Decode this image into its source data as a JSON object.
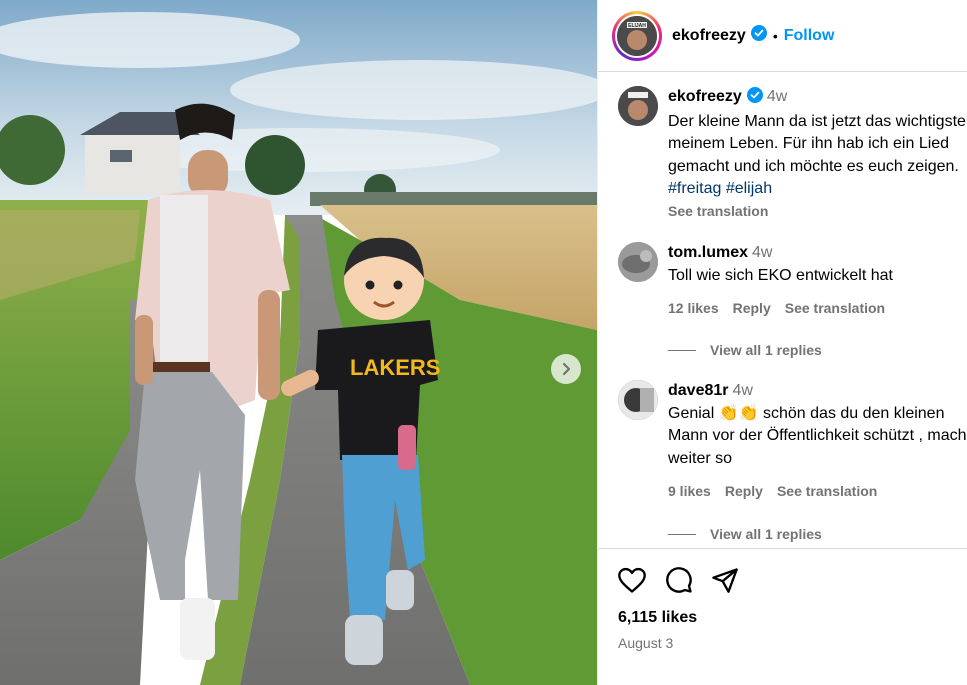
{
  "header": {
    "username": "ekofreezy",
    "separator": "•",
    "follow_label": "Follow",
    "avatar_badge": "ELIJAH"
  },
  "caption": {
    "username": "ekofreezy",
    "time": "4w",
    "text": "Der kleine Mann da ist jetzt das wichtigste in meinem Leben. Für ihn hab ich ein Lied gemacht und ich möchte es euch zeigen.",
    "hashtags": [
      "#freitag",
      "#elijah"
    ],
    "see_translation": "See translation"
  },
  "comments": [
    {
      "username": "tom.lumex",
      "time": "4w",
      "text": "Toll wie sich EKO entwickelt hat",
      "likes": "12 likes",
      "reply": "Reply",
      "see_translation": "See translation",
      "view_replies": "View all 1 replies"
    },
    {
      "username": "dave81r",
      "time": "4w",
      "text_before": "Genial",
      "emoji": "👏👏",
      "text_after": "schön das du den kleinen Mann vor der Öffentlichkeit schützt , mach weiter so",
      "likes": "9 likes",
      "reply": "Reply",
      "see_translation": "See translation",
      "view_replies": "View all 1 replies"
    }
  ],
  "post": {
    "likes": "6,115 likes",
    "date": "August 3",
    "shirt_text": "LAKERS",
    "child_emoji": "👦🏻"
  },
  "colors": {
    "link": "#0095f6",
    "hashtag": "#00376b",
    "muted": "#737373",
    "verified": "#0095f6"
  },
  "icons": [
    "heart-icon",
    "comment-icon",
    "share-icon",
    "chevron-right-icon",
    "verified-icon"
  ]
}
